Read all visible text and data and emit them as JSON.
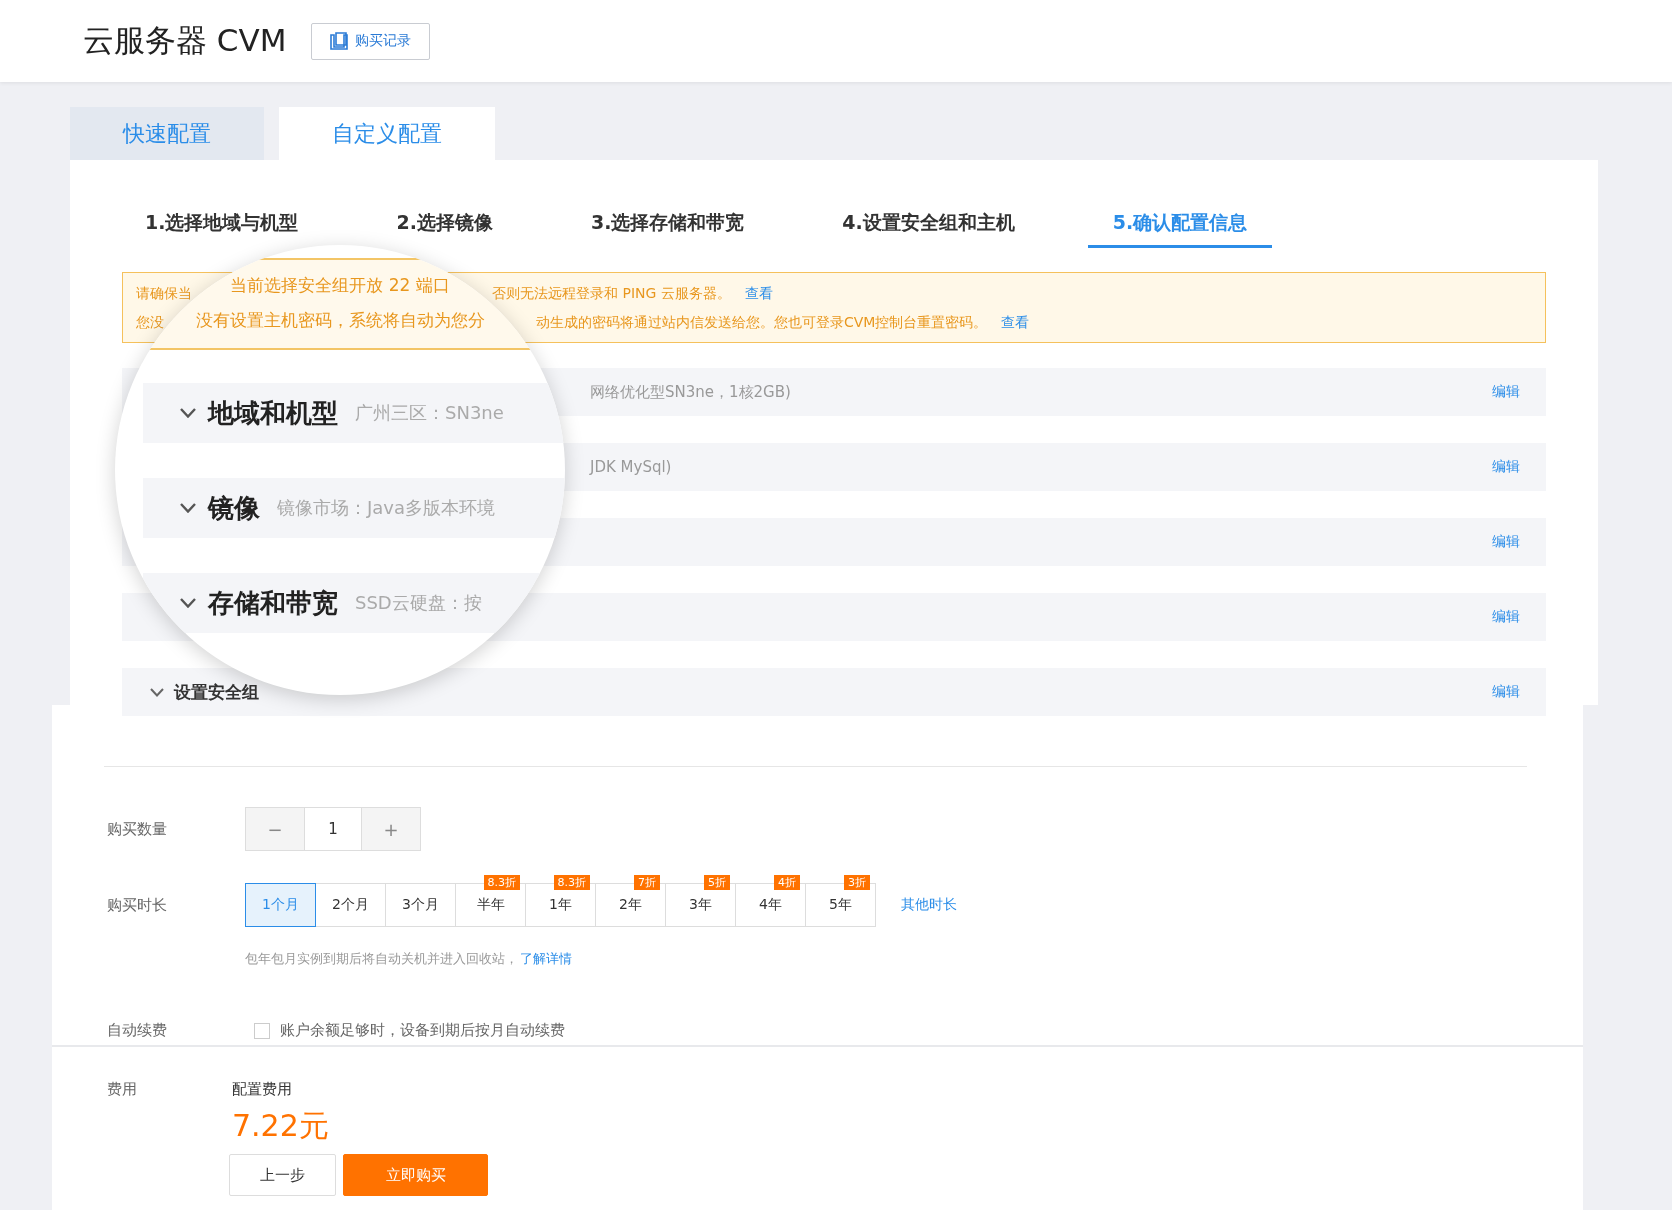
{
  "header": {
    "title": "云服务器 CVM",
    "records_button": "购买记录"
  },
  "mode_tabs": [
    {
      "label": "快速配置",
      "selected": false
    },
    {
      "label": "自定义配置",
      "selected": true
    }
  ],
  "steps": [
    {
      "label": "1.选择地域与机型",
      "selected": false
    },
    {
      "label": "2.选择镜像",
      "selected": false
    },
    {
      "label": "3.选择存储和带宽",
      "selected": false
    },
    {
      "label": "4.设置安全组和主机",
      "selected": false
    },
    {
      "label": "5.确认配置信息",
      "selected": true
    }
  ],
  "alert": {
    "lines": [
      {
        "head": "请确保当",
        "tail": "否则无法远程登录和 PING 云服务器。",
        "link": "查看"
      },
      {
        "head": "您没",
        "tail": "动生成的密码将通过站内信发送给您。您也可登录CVM控制台重置密码。",
        "link": "查看"
      }
    ]
  },
  "summary_rows": [
    {
      "value": "网络优化型SN3ne，1核2GB)",
      "edit": "编辑"
    },
    {
      "value": "JDK MySql)",
      "edit": "编辑"
    },
    {
      "edit": "编辑"
    },
    {
      "edit": "编辑"
    },
    {
      "label": "设置安全组",
      "edit": "编辑"
    }
  ],
  "magnifier": {
    "alert_lines": [
      "当前选择安全组开放 22 端口",
      "没有设置主机密码，系统将自动为您分"
    ],
    "rows": [
      {
        "label": "地域和机型",
        "value": "广州三区：SN3ne"
      },
      {
        "label": "镜像",
        "value": "镜像市场：Java多版本环境"
      },
      {
        "label": "存储和带宽",
        "value": "SSD云硬盘：按"
      }
    ]
  },
  "purchase": {
    "quantity": {
      "label": "购买数量",
      "decrement": "−",
      "value": "1",
      "increment": "+"
    },
    "duration": {
      "label": "购买时长",
      "options": [
        {
          "label": "1个月",
          "selected": true
        },
        {
          "label": "2个月",
          "selected": false
        },
        {
          "label": "3个月",
          "selected": false
        },
        {
          "label": "半年",
          "selected": false,
          "tag": "8.3折"
        },
        {
          "label": "1年",
          "selected": false,
          "tag": "8.3折"
        },
        {
          "label": "2年",
          "selected": false,
          "tag": "7折"
        },
        {
          "label": "3年",
          "selected": false,
          "tag": "5折"
        },
        {
          "label": "4年",
          "selected": false,
          "tag": "4折"
        },
        {
          "label": "5年",
          "selected": false,
          "tag": "3折"
        }
      ],
      "other_link": "其他时长",
      "note": "包年包月实例到期后将自动关机并进入回收站，",
      "note_link": "了解详情"
    },
    "auto_renew": {
      "label": "自动续费",
      "checked": false,
      "text": "账户余额足够时，设备到期后按月自动续费"
    }
  },
  "cost": {
    "label": "费用",
    "sub_label": "配置费用",
    "price": "7.22元",
    "buttons": [
      {
        "label": "上一步",
        "kind": "secondary"
      },
      {
        "label": "立即购买",
        "kind": "primary"
      }
    ]
  }
}
